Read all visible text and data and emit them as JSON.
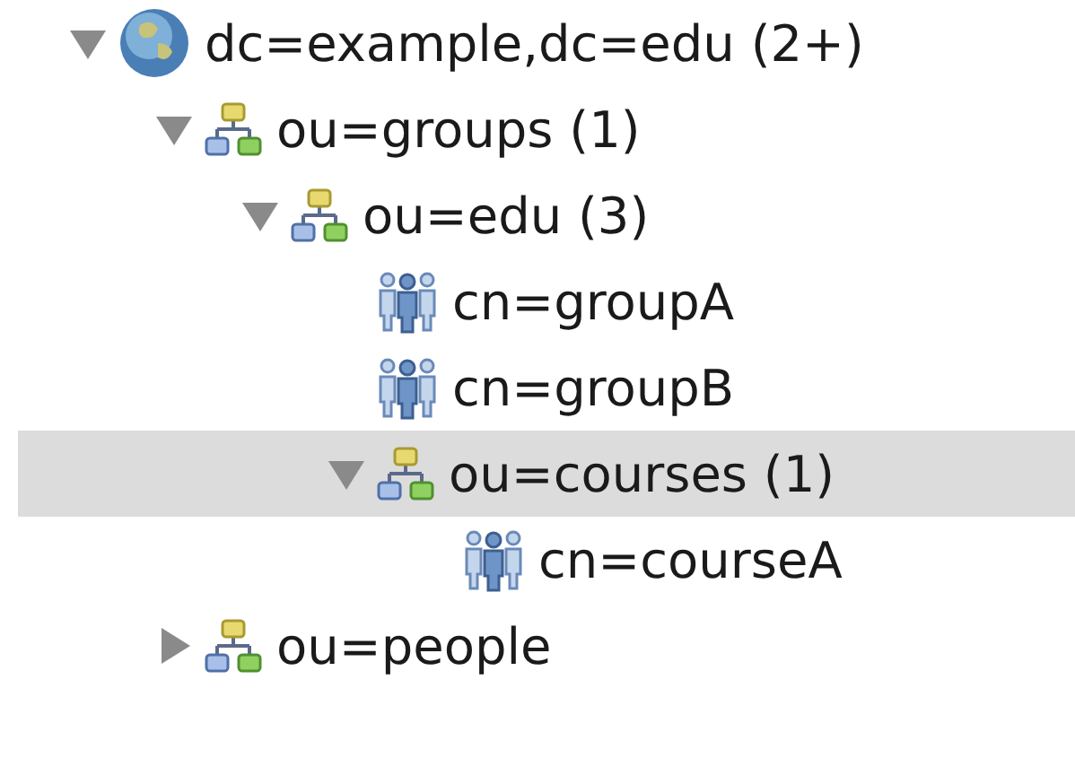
{
  "tree": [
    {
      "kind": "root",
      "label": "dc=example,dc=edu (2+)",
      "expanded": true,
      "selected": false,
      "children": [
        {
          "kind": "ou",
          "label": "ou=groups (1)",
          "expanded": true,
          "selected": false,
          "children": [
            {
              "kind": "ou",
              "label": "ou=edu (3)",
              "expanded": true,
              "selected": false,
              "children": [
                {
                  "kind": "group",
                  "label": "cn=groupA",
                  "selected": false
                },
                {
                  "kind": "group",
                  "label": "cn=groupB",
                  "selected": false
                },
                {
                  "kind": "ou",
                  "label": "ou=courses (1)",
                  "expanded": true,
                  "selected": true,
                  "children": [
                    {
                      "kind": "group",
                      "label": "cn=courseA",
                      "selected": false
                    }
                  ]
                }
              ]
            }
          ]
        },
        {
          "kind": "ou",
          "label": "ou=people",
          "expanded": false,
          "selected": false
        }
      ]
    }
  ]
}
